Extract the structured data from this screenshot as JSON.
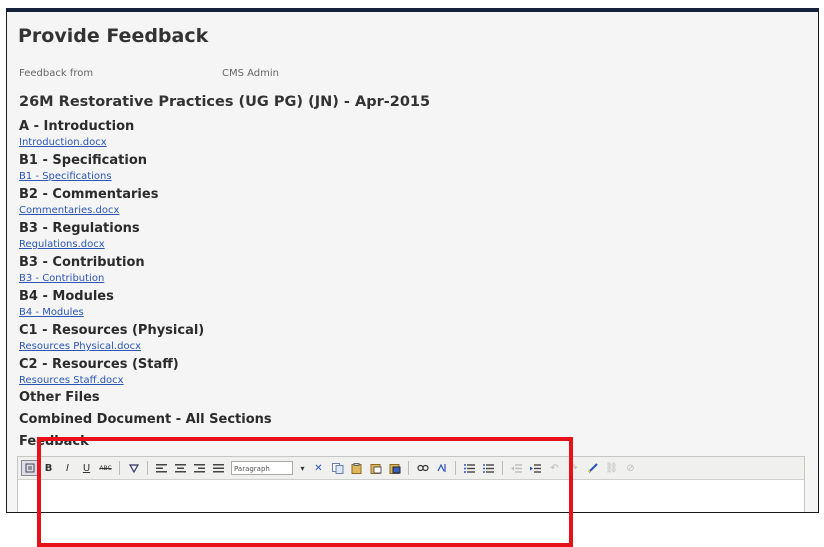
{
  "page": {
    "title": "Provide Feedback",
    "feedback_from_label": "Feedback from",
    "feedback_from_value": "CMS Admin",
    "course_title": "26M Restorative Practices (UG PG) (JN) - Apr-2015"
  },
  "sections": [
    {
      "heading": "A - Introduction",
      "link": "Introduction.docx"
    },
    {
      "heading": "B1 - Specification",
      "link": "B1 - Specifications"
    },
    {
      "heading": "B2 - Commentaries",
      "link": "Commentaries.docx"
    },
    {
      "heading": "B3 - Regulations",
      "link": "Regulations.docx"
    },
    {
      "heading": "B3 - Contribution",
      "link": "B3 - Contribution"
    },
    {
      "heading": "B4 - Modules",
      "link": "B4 - Modules"
    },
    {
      "heading": "C1 - Resources (Physical)",
      "link": "Resources Physical.docx"
    },
    {
      "heading": "C2 - Resources (Staff)",
      "link": "Resources Staff.docx"
    }
  ],
  "other_files_label": "Other Files",
  "combined_label": "Combined Document - All Sections",
  "feedback_label": "Feedback",
  "toolbar": {
    "bold": "B",
    "italic": "I",
    "underline": "U",
    "strike": "ABC",
    "format_select": "Paragraph"
  },
  "colors": {
    "link": "#2a55b8",
    "highlight": "#e8111a",
    "header_bar": "#15203a"
  }
}
